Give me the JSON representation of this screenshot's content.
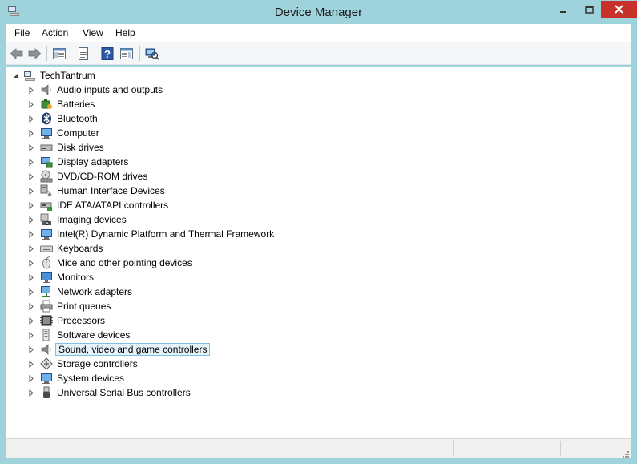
{
  "window": {
    "title": "Device Manager"
  },
  "menu": [
    "File",
    "Action",
    "View",
    "Help"
  ],
  "toolbar": [
    "back-icon",
    "forward-icon",
    "show-hide-console-tree-icon",
    "properties-icon",
    "help-icon",
    "show-action-pane-icon",
    "scan-hardware-icon"
  ],
  "tree": {
    "root": "TechTantrum",
    "items": [
      {
        "label": "Audio inputs and outputs",
        "icon": "speaker-icon"
      },
      {
        "label": "Batteries",
        "icon": "battery-icon"
      },
      {
        "label": "Bluetooth",
        "icon": "bluetooth-icon"
      },
      {
        "label": "Computer",
        "icon": "computer-icon"
      },
      {
        "label": "Disk drives",
        "icon": "disk-drive-icon"
      },
      {
        "label": "Display adapters",
        "icon": "display-adapter-icon"
      },
      {
        "label": "DVD/CD-ROM drives",
        "icon": "dvd-drive-icon"
      },
      {
        "label": "Human Interface Devices",
        "icon": "hid-icon"
      },
      {
        "label": "IDE ATA/ATAPI controllers",
        "icon": "ide-controller-icon"
      },
      {
        "label": "Imaging devices",
        "icon": "camera-icon"
      },
      {
        "label": "Intel(R) Dynamic Platform and Thermal Framework",
        "icon": "computer-icon"
      },
      {
        "label": "Keyboards",
        "icon": "keyboard-icon"
      },
      {
        "label": "Mice and other pointing devices",
        "icon": "mouse-icon"
      },
      {
        "label": "Monitors",
        "icon": "monitor-icon"
      },
      {
        "label": "Network adapters",
        "icon": "network-adapter-icon"
      },
      {
        "label": "Print queues",
        "icon": "printer-icon"
      },
      {
        "label": "Processors",
        "icon": "processor-icon"
      },
      {
        "label": "Software devices",
        "icon": "software-device-icon"
      },
      {
        "label": "Sound, video and game controllers",
        "icon": "speaker-icon",
        "selected": true
      },
      {
        "label": "Storage controllers",
        "icon": "storage-controller-icon"
      },
      {
        "label": "System devices",
        "icon": "computer-icon"
      },
      {
        "label": "Universal Serial Bus controllers",
        "icon": "usb-icon"
      }
    ]
  },
  "colors": {
    "frame": "#9fd3dc",
    "close": "#c7312a",
    "selection_bg": "#e5f3fb",
    "selection_border": "#7fc0e6"
  }
}
